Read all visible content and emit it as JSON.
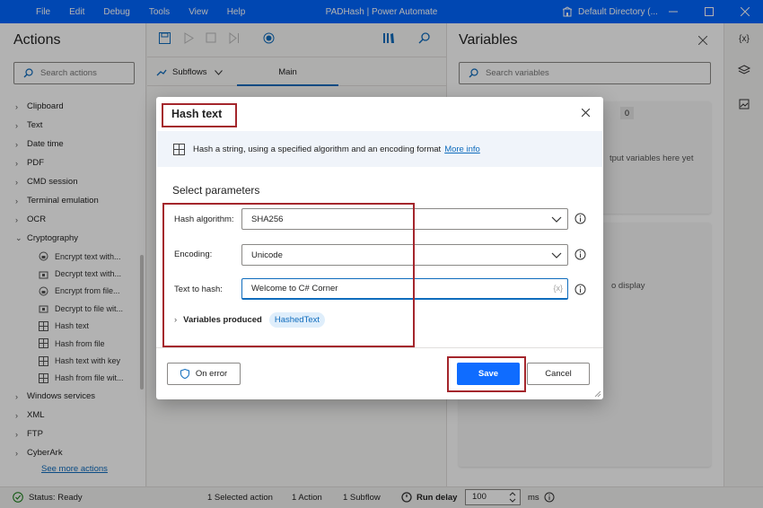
{
  "titlebar": {
    "menu": [
      "File",
      "Edit",
      "Debug",
      "Tools",
      "View",
      "Help"
    ],
    "title": "PADHash | Power Automate",
    "directory": "Default Directory (..."
  },
  "actions": {
    "heading": "Actions",
    "search_placeholder": "Search actions",
    "categories_top": [
      "Clipboard",
      "Text",
      "Date time",
      "PDF",
      "CMD session",
      "Terminal emulation",
      "OCR",
      "Cryptography"
    ],
    "crypto_items": [
      "Encrypt text with...",
      "Decrypt text with...",
      "Encrypt from file...",
      "Decrypt to file wit...",
      "Hash text",
      "Hash from file",
      "Hash text with key",
      "Hash from file wit..."
    ],
    "categories_bottom": [
      "Windows services",
      "XML",
      "FTP",
      "CyberArk"
    ],
    "see_more": "See more actions"
  },
  "center": {
    "subflows_label": "Subflows",
    "main_tab": "Main"
  },
  "variables": {
    "heading": "Variables",
    "search_placeholder": "Search variables",
    "input_count": "0",
    "output_hint": "tput variables here yet",
    "display_hint": "o display"
  },
  "rail": {
    "var_icon_text": "{x}"
  },
  "dialog": {
    "title": "Hash text",
    "description": "Hash a string, using a specified algorithm and an encoding format",
    "more_info": "More info",
    "section": "Select parameters",
    "hash_algorithm_label": "Hash algorithm:",
    "hash_algorithm_value": "SHA256",
    "encoding_label": "Encoding:",
    "encoding_value": "Unicode",
    "text_label": "Text to hash:",
    "text_value": "Welcome to C# Corner",
    "fx": "{x}",
    "variables_produced": "Variables produced",
    "variable_name": "HashedText",
    "on_error": "On error",
    "save": "Save",
    "cancel": "Cancel"
  },
  "status": {
    "ready": "Status: Ready",
    "selected": "1 Selected action",
    "action_count": "1 Action",
    "subflow_count": "1 Subflow",
    "run_delay_label": "Run delay",
    "run_delay_value": "100",
    "unit": "ms"
  },
  "colors": {
    "accent": "#0066ff",
    "highlight_box": "#a4262c"
  }
}
